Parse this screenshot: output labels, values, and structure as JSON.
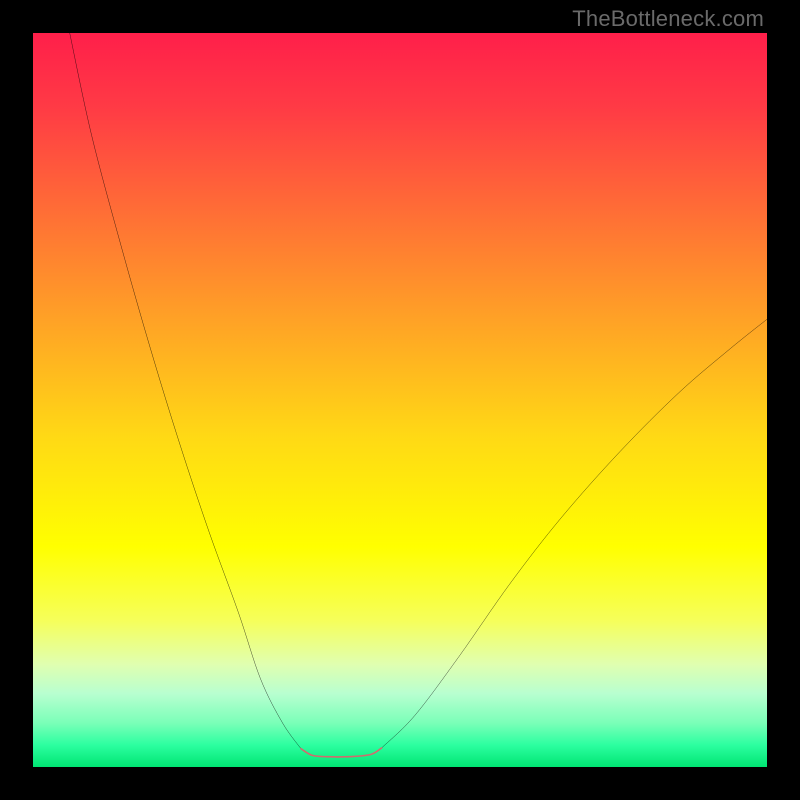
{
  "attribution": "TheBottleneck.com",
  "colors": {
    "frame": "#000000",
    "curve_stroke": "#000000",
    "lowband_stroke": "#cf6d6e",
    "attribution_text": "#6a6a6a",
    "gradient_stops": [
      {
        "offset": 0.0,
        "color": "#ff1f4a"
      },
      {
        "offset": 0.1,
        "color": "#ff3a45"
      },
      {
        "offset": 0.25,
        "color": "#ff7035"
      },
      {
        "offset": 0.4,
        "color": "#ffa525"
      },
      {
        "offset": 0.55,
        "color": "#ffd915"
      },
      {
        "offset": 0.7,
        "color": "#ffff00"
      },
      {
        "offset": 0.8,
        "color": "#f6ff5a"
      },
      {
        "offset": 0.86,
        "color": "#e0ffb0"
      },
      {
        "offset": 0.9,
        "color": "#b8ffd0"
      },
      {
        "offset": 0.94,
        "color": "#7affb8"
      },
      {
        "offset": 0.97,
        "color": "#2cffa0"
      },
      {
        "offset": 1.0,
        "color": "#00e573"
      }
    ]
  },
  "chart_data": {
    "type": "line",
    "title": "",
    "xlabel": "",
    "ylabel": "",
    "xlim": [
      0,
      100
    ],
    "ylim": [
      0,
      100
    ],
    "grid": false,
    "legend": false,
    "note": "V-shaped bottleneck curve with asymmetric sides; flat bottom segment highlighted. Values estimated from pixel positions.",
    "series": [
      {
        "name": "left-branch",
        "x": [
          5.0,
          8.0,
          12.0,
          16.0,
          20.0,
          24.0,
          28.0,
          31.0,
          34.0,
          36.5
        ],
        "y": [
          100.0,
          86.0,
          71.0,
          57.0,
          44.0,
          32.0,
          21.0,
          12.0,
          6.0,
          2.5
        ]
      },
      {
        "name": "flat-bottom-highlight",
        "x": [
          36.5,
          38.0,
          40.0,
          43.0,
          46.0,
          47.5
        ],
        "y": [
          2.5,
          1.6,
          1.4,
          1.4,
          1.7,
          2.6
        ]
      },
      {
        "name": "right-branch",
        "x": [
          47.5,
          52.0,
          58.0,
          65.0,
          72.0,
          80.0,
          88.0,
          95.0,
          100.0
        ],
        "y": [
          2.6,
          7.0,
          15.0,
          25.0,
          34.0,
          43.0,
          51.0,
          57.0,
          61.0
        ]
      }
    ]
  }
}
